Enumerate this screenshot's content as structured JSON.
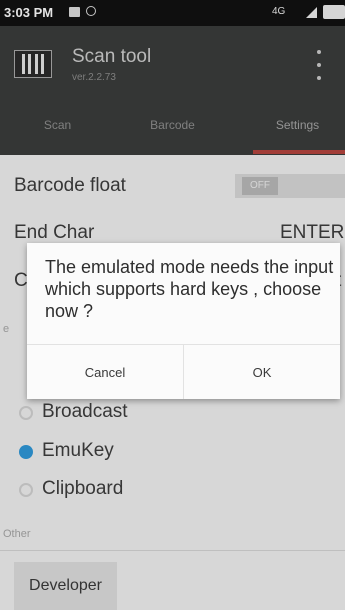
{
  "status_bar": {
    "time": "3:03 PM",
    "network": "4G"
  },
  "app": {
    "title": "Scan tool",
    "version": "ver.2.2.73"
  },
  "tabs": [
    {
      "label": "Scan",
      "selected": false
    },
    {
      "label": "Barcode",
      "selected": false
    },
    {
      "label": "Settings",
      "selected": true
    }
  ],
  "settings": {
    "barcode_float": {
      "label": "Barcode float",
      "toggle": "OFF"
    },
    "end_char": {
      "label": "End Char",
      "value": "ENTER"
    },
    "hidden_row_prefix": "C",
    "hidden_row_suffix": "t",
    "hidden_section_prefix": "e",
    "output_options": [
      {
        "label": "Broadcast",
        "selected": false
      },
      {
        "label": "EmuKey",
        "selected": true
      },
      {
        "label": "Clipboard",
        "selected": false
      }
    ],
    "other_section": "Other",
    "developer_button": "Developer"
  },
  "dialog": {
    "message": "The emulated mode needs the input which supports hard keys , choose now ?",
    "cancel": "Cancel",
    "ok": "OK"
  },
  "colors": {
    "accent": "#2f98d8",
    "tab_indicator": "#b5463f",
    "app_bar": "#3a3d3b"
  }
}
